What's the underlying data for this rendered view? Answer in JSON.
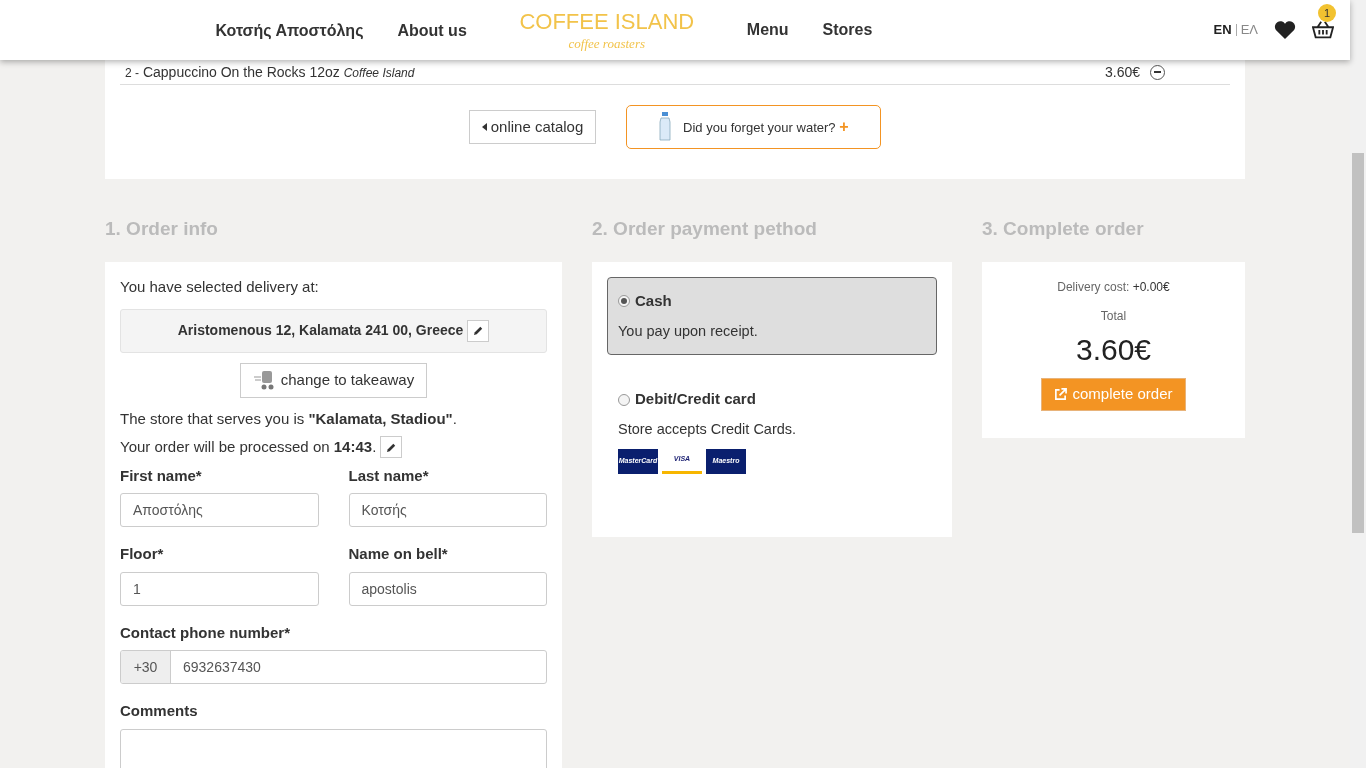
{
  "header": {
    "nav_left": [
      "Κοτσής Αποστόλης",
      "About us"
    ],
    "logo": {
      "name": "COFFEE ISLAND",
      "tagline": "coffee roasters"
    },
    "nav_right": [
      "Menu",
      "Stores"
    ],
    "languages": [
      {
        "label": "EN",
        "selected": true
      },
      {
        "label": "ΕΛ",
        "selected": false
      }
    ],
    "cart_count": "1"
  },
  "cart": {
    "items": [
      {
        "qty": "2 -",
        "name": "Cappuccino On the Rocks 12oz",
        "brand": "Coffee Island",
        "price": "3.60€"
      }
    ],
    "catalog_button": "online catalog",
    "water_button": "Did you forget your water?",
    "water_plus": "+"
  },
  "order_info": {
    "heading": "1. Order info",
    "delivery_intro": "You have selected delivery at:",
    "address": "Aristomenous 12, Kalamata 241 00, Greece",
    "takeaway_button": "change to takeaway",
    "store_text": "The store that serves you is **\"Kalamata, Stadiou\"**.",
    "time_text": "Your order will be processed on **14:43**.",
    "fields": [
      {
        "label": "First name*",
        "value": "Αποστόλης"
      },
      {
        "label": "Last name*",
        "value": "Κοτσής"
      },
      {
        "label": "Floor*",
        "value": "1"
      },
      {
        "label": "Name on bell*",
        "value": "apostolis"
      }
    ],
    "phone": {
      "label": "Contact phone number*",
      "prefix": "+30",
      "value": "6932637430"
    },
    "comments": {
      "label": "Comments"
    }
  },
  "payment": {
    "heading": "2. Order payment pethod",
    "options": [
      {
        "title": "Cash",
        "description": "You pay upon receipt.",
        "selected": true
      },
      {
        "title": "Debit/Credit card",
        "description": "Store accepts Credit Cards.",
        "selected": false,
        "cards": [
          "MasterCard",
          "VISA",
          "Maestro"
        ]
      }
    ]
  },
  "complete": {
    "heading": "3. Complete order",
    "delivery_label": "Delivery cost:",
    "delivery_value": "+0.00€",
    "total_label": "Total",
    "total": "3.60€",
    "button": "complete order"
  }
}
